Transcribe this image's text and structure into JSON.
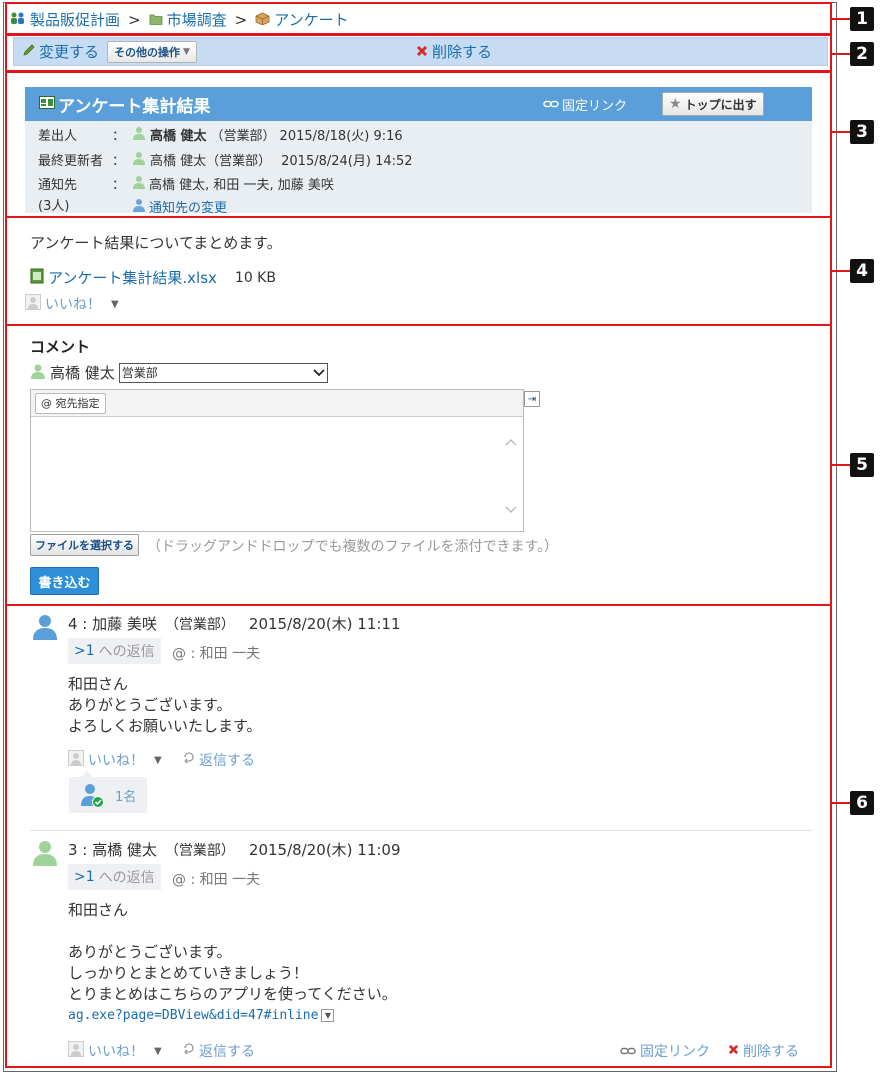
{
  "breadcrumb": {
    "app": "製品販促計画",
    "folder": "市場調査",
    "topic": "アンケート",
    "sep": ">"
  },
  "toolbar": {
    "edit": "変更する",
    "more": "その他の操作",
    "delete": "削除する"
  },
  "topic": {
    "title": "アンケート集計結果",
    "permalink": "固定リンク",
    "top_button": "トップに出す",
    "sender_label": "差出人",
    "sender_name": "高橋 健太",
    "sender_dept": "（営業部）",
    "sender_date": "2015/8/18(火) 9:16",
    "updater_label": "最終更新者",
    "updater_name": "高橋 健太（営業部）",
    "updater_date": "2015/8/24(月) 14:52",
    "notify_label": "通知先",
    "notify_count": "(3人)",
    "notify_names": "高橋 健太, 和田 一夫, 加藤 美咲",
    "notify_change": "通知先の変更",
    "colon": "："
  },
  "body": {
    "text": "アンケート結果についてまとめます。",
    "file_name": "アンケート集計結果.xlsx",
    "file_size": "10 KB",
    "like": "いいね！"
  },
  "comment_form": {
    "heading": "コメント",
    "poster": "高橋 健太",
    "dept_selected": "営業部",
    "mention_button": "@ 宛先指定",
    "file_button": "ファイルを選択する",
    "file_hint": "（ドラッグアンドドロップでも複数のファイルを添付できます。）",
    "submit": "書き込む"
  },
  "comments": [
    {
      "number_author": "4 : 加藤 美咲",
      "dept": "（営業部）",
      "date": "2015/8/20(木) 11:11",
      "reply_ref": ">1",
      "reply_suffix": "への返信",
      "mention": "@ : 和田 一夫",
      "lines": [
        "和田さん",
        "ありがとうございます。",
        "よろしくお願いいたします。"
      ],
      "like": "いいね！",
      "reply": "返信する",
      "like_count": "1名"
    },
    {
      "number_author": "3 : 高橋 健太",
      "dept": "（営業部）",
      "date": "2015/8/20(木) 11:09",
      "reply_ref": ">1",
      "reply_suffix": "への返信",
      "mention": "@ : 和田 一夫",
      "lines": [
        "和田さん",
        "",
        "ありがとうございます。",
        "しっかりとまとめていきましょう！",
        "とりまとめはこちらのアプリを使ってください。"
      ],
      "url": "ag.exe?page=DBView&did=47#inline",
      "like": "いいね！",
      "reply": "返信する",
      "permalink": "固定リンク",
      "delete": "削除する"
    }
  ],
  "badges": [
    "1",
    "2",
    "3",
    "4",
    "5",
    "6"
  ],
  "colors": {
    "accent": "#5a9fd9",
    "toolbar_bg": "#c7dcf2",
    "link": "#1a6dad",
    "highlight_border": "#e0161b",
    "delete_x": "#d62b2b"
  }
}
